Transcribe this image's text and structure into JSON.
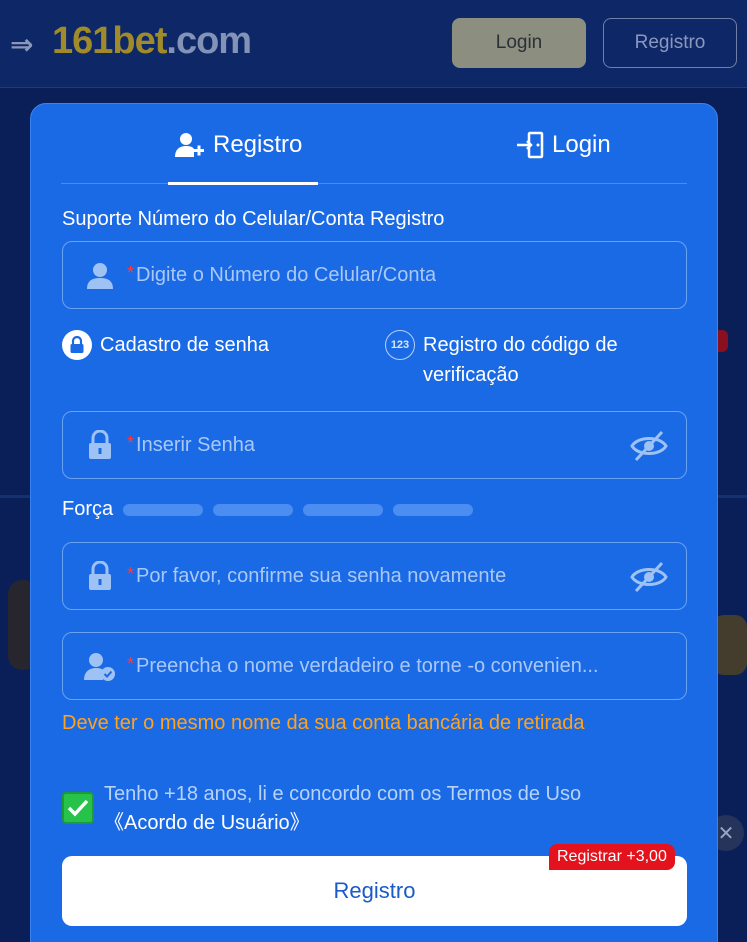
{
  "background": {
    "logo_main": "161bet",
    "logo_tld": ".com",
    "login_button": "Login",
    "register_button": "Registro"
  },
  "modal": {
    "tabs": [
      {
        "label": "Registro",
        "icon": "user-plus-icon",
        "active": true
      },
      {
        "label": "Login",
        "icon": "login-door-icon",
        "active": false
      }
    ],
    "section_title": "Suporte Número do Celular/Conta Registro",
    "account_field": {
      "required_mark": "*",
      "placeholder": "Digite o Número do Celular/Conta",
      "icon": "user-icon"
    },
    "options": {
      "password": "Cadastro de senha",
      "code": "Registro do código de verificação",
      "code_icon_text": "123"
    },
    "password_field": {
      "required_mark": "*",
      "placeholder": "Inserir Senha",
      "icon": "lock-icon"
    },
    "strength": {
      "label": "Força",
      "segments": 4
    },
    "confirm_field": {
      "required_mark": "*",
      "placeholder": "Por favor, confirme sua senha novamente",
      "icon": "lock-icon"
    },
    "name_field": {
      "required_mark": "*",
      "placeholder": "Preencha o nome verdadeiro e torne -o convenien...",
      "icon": "user-check-icon"
    },
    "name_warning": "Deve ter o mesmo nome da sua conta bancária de retirada",
    "agreement": {
      "checked": true,
      "text": "Tenho +18 anos, li e concordo com os Termos de Uso",
      "link": "《Acordo de Usuário》"
    },
    "submit_label": "Registro",
    "bonus_badge": "Registrar +3,00"
  },
  "colors": {
    "modal_bg": "#1a6ae6",
    "warning": "#ffa21c",
    "checkbox": "#27c24a",
    "badge": "#e3121c"
  }
}
